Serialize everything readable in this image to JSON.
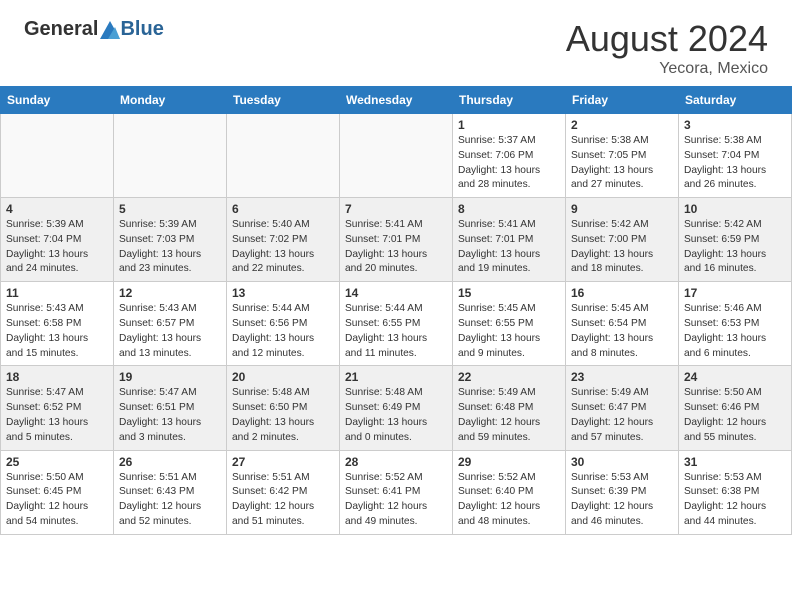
{
  "header": {
    "logo_general": "General",
    "logo_blue": "Blue",
    "month": "August 2024",
    "location": "Yecora, Mexico"
  },
  "days_of_week": [
    "Sunday",
    "Monday",
    "Tuesday",
    "Wednesday",
    "Thursday",
    "Friday",
    "Saturday"
  ],
  "weeks": [
    [
      {
        "day": "",
        "info": ""
      },
      {
        "day": "",
        "info": ""
      },
      {
        "day": "",
        "info": ""
      },
      {
        "day": "",
        "info": ""
      },
      {
        "day": "1",
        "info": "Sunrise: 5:37 AM\nSunset: 7:06 PM\nDaylight: 13 hours\nand 28 minutes."
      },
      {
        "day": "2",
        "info": "Sunrise: 5:38 AM\nSunset: 7:05 PM\nDaylight: 13 hours\nand 27 minutes."
      },
      {
        "day": "3",
        "info": "Sunrise: 5:38 AM\nSunset: 7:04 PM\nDaylight: 13 hours\nand 26 minutes."
      }
    ],
    [
      {
        "day": "4",
        "info": "Sunrise: 5:39 AM\nSunset: 7:04 PM\nDaylight: 13 hours\nand 24 minutes."
      },
      {
        "day": "5",
        "info": "Sunrise: 5:39 AM\nSunset: 7:03 PM\nDaylight: 13 hours\nand 23 minutes."
      },
      {
        "day": "6",
        "info": "Sunrise: 5:40 AM\nSunset: 7:02 PM\nDaylight: 13 hours\nand 22 minutes."
      },
      {
        "day": "7",
        "info": "Sunrise: 5:41 AM\nSunset: 7:01 PM\nDaylight: 13 hours\nand 20 minutes."
      },
      {
        "day": "8",
        "info": "Sunrise: 5:41 AM\nSunset: 7:01 PM\nDaylight: 13 hours\nand 19 minutes."
      },
      {
        "day": "9",
        "info": "Sunrise: 5:42 AM\nSunset: 7:00 PM\nDaylight: 13 hours\nand 18 minutes."
      },
      {
        "day": "10",
        "info": "Sunrise: 5:42 AM\nSunset: 6:59 PM\nDaylight: 13 hours\nand 16 minutes."
      }
    ],
    [
      {
        "day": "11",
        "info": "Sunrise: 5:43 AM\nSunset: 6:58 PM\nDaylight: 13 hours\nand 15 minutes."
      },
      {
        "day": "12",
        "info": "Sunrise: 5:43 AM\nSunset: 6:57 PM\nDaylight: 13 hours\nand 13 minutes."
      },
      {
        "day": "13",
        "info": "Sunrise: 5:44 AM\nSunset: 6:56 PM\nDaylight: 13 hours\nand 12 minutes."
      },
      {
        "day": "14",
        "info": "Sunrise: 5:44 AM\nSunset: 6:55 PM\nDaylight: 13 hours\nand 11 minutes."
      },
      {
        "day": "15",
        "info": "Sunrise: 5:45 AM\nSunset: 6:55 PM\nDaylight: 13 hours\nand 9 minutes."
      },
      {
        "day": "16",
        "info": "Sunrise: 5:45 AM\nSunset: 6:54 PM\nDaylight: 13 hours\nand 8 minutes."
      },
      {
        "day": "17",
        "info": "Sunrise: 5:46 AM\nSunset: 6:53 PM\nDaylight: 13 hours\nand 6 minutes."
      }
    ],
    [
      {
        "day": "18",
        "info": "Sunrise: 5:47 AM\nSunset: 6:52 PM\nDaylight: 13 hours\nand 5 minutes."
      },
      {
        "day": "19",
        "info": "Sunrise: 5:47 AM\nSunset: 6:51 PM\nDaylight: 13 hours\nand 3 minutes."
      },
      {
        "day": "20",
        "info": "Sunrise: 5:48 AM\nSunset: 6:50 PM\nDaylight: 13 hours\nand 2 minutes."
      },
      {
        "day": "21",
        "info": "Sunrise: 5:48 AM\nSunset: 6:49 PM\nDaylight: 13 hours\nand 0 minutes."
      },
      {
        "day": "22",
        "info": "Sunrise: 5:49 AM\nSunset: 6:48 PM\nDaylight: 12 hours\nand 59 minutes."
      },
      {
        "day": "23",
        "info": "Sunrise: 5:49 AM\nSunset: 6:47 PM\nDaylight: 12 hours\nand 57 minutes."
      },
      {
        "day": "24",
        "info": "Sunrise: 5:50 AM\nSunset: 6:46 PM\nDaylight: 12 hours\nand 55 minutes."
      }
    ],
    [
      {
        "day": "25",
        "info": "Sunrise: 5:50 AM\nSunset: 6:45 PM\nDaylight: 12 hours\nand 54 minutes."
      },
      {
        "day": "26",
        "info": "Sunrise: 5:51 AM\nSunset: 6:43 PM\nDaylight: 12 hours\nand 52 minutes."
      },
      {
        "day": "27",
        "info": "Sunrise: 5:51 AM\nSunset: 6:42 PM\nDaylight: 12 hours\nand 51 minutes."
      },
      {
        "day": "28",
        "info": "Sunrise: 5:52 AM\nSunset: 6:41 PM\nDaylight: 12 hours\nand 49 minutes."
      },
      {
        "day": "29",
        "info": "Sunrise: 5:52 AM\nSunset: 6:40 PM\nDaylight: 12 hours\nand 48 minutes."
      },
      {
        "day": "30",
        "info": "Sunrise: 5:53 AM\nSunset: 6:39 PM\nDaylight: 12 hours\nand 46 minutes."
      },
      {
        "day": "31",
        "info": "Sunrise: 5:53 AM\nSunset: 6:38 PM\nDaylight: 12 hours\nand 44 minutes."
      }
    ]
  ]
}
